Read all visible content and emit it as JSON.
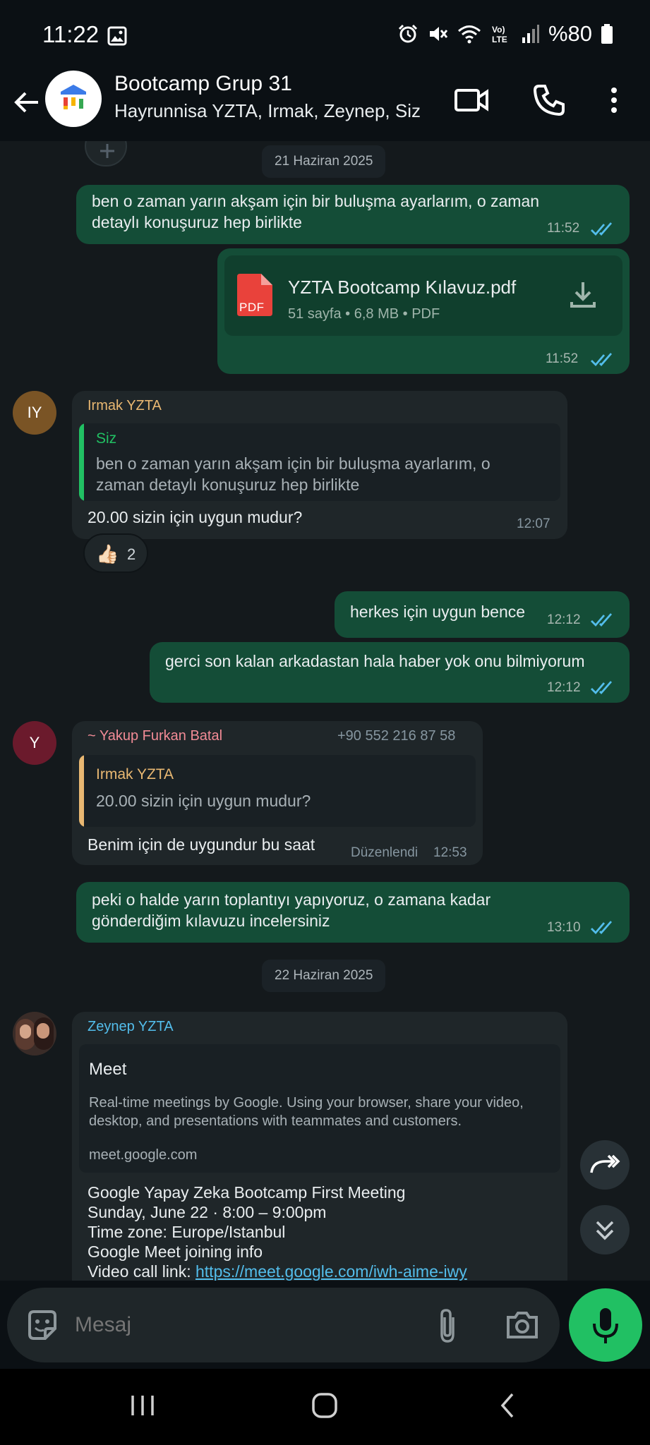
{
  "status_bar": {
    "time": "11:22",
    "battery": "%80",
    "icons": [
      "gallery-icon",
      "alarm-icon",
      "mute-icon",
      "wifi-icon",
      "volte-icon",
      "signal-icon",
      "battery-icon"
    ]
  },
  "header": {
    "title": "Bootcamp Grup 31",
    "subtitle": "Hayrunnisa YZTA, Irmak, Zeynep, Siz",
    "icons": [
      "back-arrow-icon",
      "video-call-icon",
      "phone-call-icon",
      "more-vert-icon"
    ]
  },
  "chat": {
    "date_1": "21 Haziran 2025",
    "date_2": "22 Haziran 2025",
    "messages": [
      {
        "direction": "out",
        "lines": [
          "ben o zaman yarın akşam için bir buluşma ayarlarım, o zaman",
          "detaylı konuşuruz hep birlikte"
        ],
        "time": "11:52"
      },
      {
        "direction": "out",
        "type": "document",
        "file_badge": "PDF",
        "file_name": "YZTA Bootcamp Kılavuz.pdf",
        "file_meta": "51 sayfa • 6,8 MB • PDF",
        "time": "11:52"
      },
      {
        "direction": "in",
        "avatar": "IY",
        "sender": "Irmak YZTA",
        "quote_name": "Siz",
        "quote_lines": [
          "ben o zaman yarın akşam için bir buluşma ayarlarım, o",
          "zaman detaylı konuşuruz hep birlikte"
        ],
        "text": "20.00 sizin için uygun mudur?",
        "time": "12:07",
        "reaction_emoji": "👍🏻",
        "reaction_count": "2"
      },
      {
        "direction": "out",
        "text": "herkes için uygun bence",
        "time": "12:12"
      },
      {
        "direction": "out",
        "text": "gerci son kalan arkadastan hala haber yok onu bilmiyorum",
        "time": "12:12"
      },
      {
        "direction": "in",
        "avatar": "Y",
        "sender": "~ Yakup Furkan Batal",
        "phone": "+90 552 216 87 58",
        "quote_name": "Irmak YZTA",
        "quote_text": "20.00 sizin için uygun mudur?",
        "text": "Benim için de uygundur bu saat",
        "edited": "Düzenlendi",
        "time": "12:53"
      },
      {
        "direction": "out",
        "lines": [
          "peki o halde yarın toplantıyı yapıyoruz, o zamana kadar",
          "gönderdiğim kılavuzu incelersiniz"
        ],
        "time": "13:10"
      },
      {
        "direction": "in",
        "sender": "Zeynep YZTA",
        "preview_title": "Meet",
        "preview_desc": [
          "Real-time meetings by Google. Using your browser, share your video,",
          "desktop, and presentations with teammates and customers."
        ],
        "preview_domain": "meet.google.com",
        "body_lines": [
          "Google Yapay Zeka Bootcamp First Meeting",
          "Sunday, June 22 · 8:00 – 9:00pm",
          "Time zone: Europe/Istanbul",
          "Google Meet joining info"
        ],
        "link_label": "Video call link: ",
        "link_url": "https://meet.google.com/iwh-aime-iwy"
      }
    ]
  },
  "input": {
    "placeholder": "Mesaj",
    "icons": [
      "sticker-icon",
      "attach-icon",
      "camera-icon",
      "mic-icon"
    ]
  },
  "colors": {
    "outgoing_bubble": "#144d37",
    "incoming_bubble": "#1f2629",
    "chat_background": "#14191c",
    "accent_green": "#21c063",
    "read_ticks": "#53bdeb",
    "irmak_name": "#e9b872",
    "yakup_name": "#f28b96",
    "zeynep_name": "#53bdeb"
  }
}
